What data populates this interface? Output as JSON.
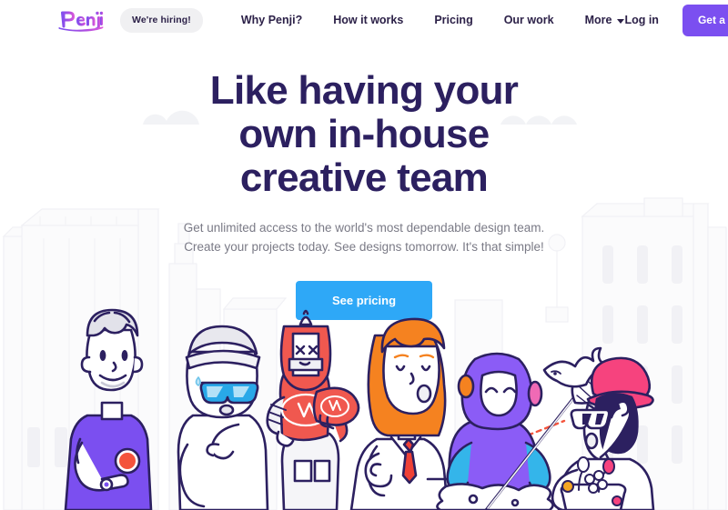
{
  "brand": {
    "logo_text": "Penji",
    "logo_gradient_start": "#7b4ff0",
    "logo_gradient_end": "#e05bd8"
  },
  "nav": {
    "hiring_badge": "We're hiring!",
    "links": [
      {
        "label": "Why Penji?",
        "has_caret": false
      },
      {
        "label": "How it works",
        "has_caret": false
      },
      {
        "label": "Pricing",
        "has_caret": false
      },
      {
        "label": "Our work",
        "has_caret": false
      },
      {
        "label": "More",
        "has_caret": true
      }
    ],
    "login_label": "Log in",
    "demo_label": "Get a Demo",
    "demo_color": "#7b4ff0",
    "text_color": "#2c2148",
    "badge_bg": "#f0f0f2"
  },
  "hero": {
    "headline_lines": [
      "Like having your",
      "own in-house",
      "creative team"
    ],
    "headline_color": "#2c2060",
    "subhead_lines": [
      "Get unlimited access to the world's most dependable design team.",
      "Create your projects today. See designs tomorrow. It's that simple!"
    ],
    "subhead_color": "#7a7a86",
    "cta_label": "See pricing",
    "cta_color": "#2ea8f7"
  },
  "illustration": {
    "alt": "team-of-illustrated-creative-characters",
    "background_alt": "faint-city-skyline-and-clouds",
    "characters": [
      {
        "name": "man-purple-shirt",
        "shirt_color": "#7b4ff0",
        "accent": "#f4543c",
        "hair": "#d8d8e2"
      },
      {
        "name": "white-mascot-sunglasses",
        "glasses_color": "#29a8e8"
      },
      {
        "name": "red-robot-astronaut",
        "suit_color": "#f0584f"
      },
      {
        "name": "woman-orange-hair-labcoat",
        "hair_color": "#f58220",
        "tie_color": "#ef4136"
      },
      {
        "name": "purple-hooded-ninja",
        "hood_color": "#8b5cf6",
        "scarf_color": "#34b5ea"
      },
      {
        "name": "person-pink-hat-net",
        "hat_color": "#f6437e",
        "hair_color": "#2c2060"
      }
    ],
    "building_color": "#f4f4f7",
    "cloud_color": "#f2f3f6"
  }
}
